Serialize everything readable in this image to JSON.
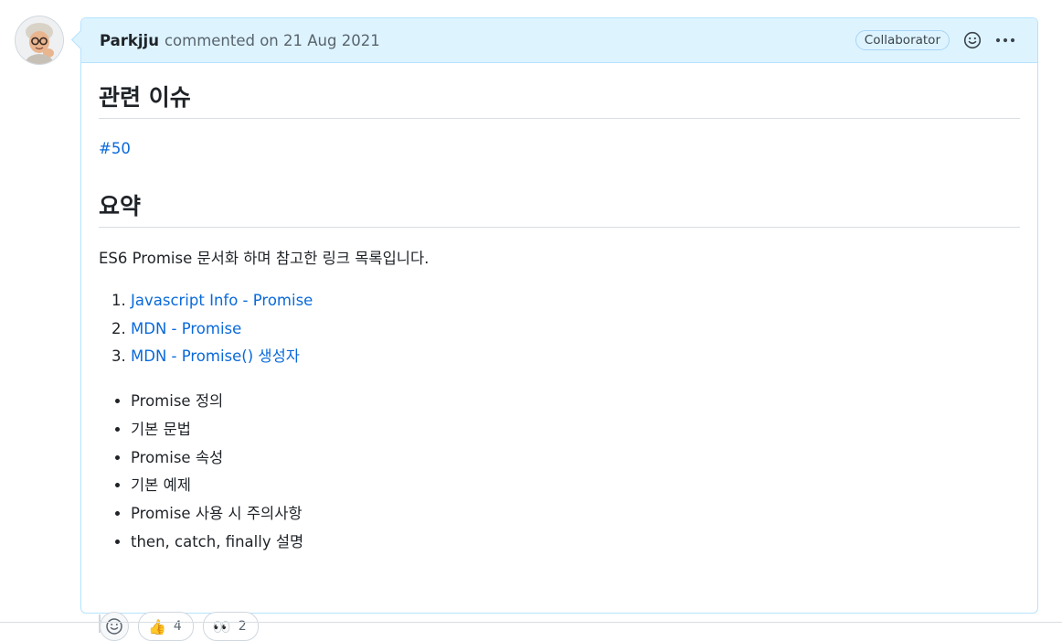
{
  "comment": {
    "author": "Parkjju",
    "meta": "commented on 21 Aug 2021",
    "role_badge": "Collaborator",
    "icons": {
      "emoji": "smiley-icon",
      "menu": "kebab-horizontal-icon"
    }
  },
  "body": {
    "heading_issue": "관련 이슈",
    "issue_link": "#50",
    "heading_summary": "요약",
    "summary_text": "ES6 Promise 문서화 하며 참고한 링크 목록입니다.",
    "links": [
      {
        "label": "Javascript Info - Promise"
      },
      {
        "label": "MDN - Promise"
      },
      {
        "label": "MDN - Promise() 생성자"
      }
    ],
    "bullets": [
      "Promise 정의",
      "기본 문법",
      "Promise 속성",
      "기본 예제",
      "Promise 사용 시 주의사항",
      "then, catch, finally 설명"
    ]
  },
  "reactions": [
    {
      "icon": "thumbs-up-icon",
      "emoji": "👍",
      "count": "4"
    },
    {
      "icon": "eyes-icon",
      "emoji": "👀",
      "count": "2"
    }
  ],
  "colors": {
    "link": "#0969da",
    "header_bg": "#ddf4ff",
    "border": "#b6e3ff"
  }
}
